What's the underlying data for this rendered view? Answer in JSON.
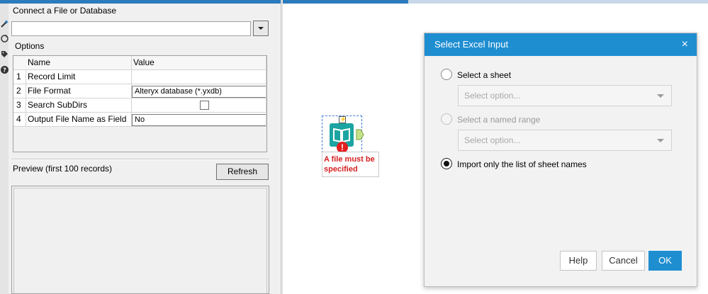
{
  "left_panel": {
    "connect_label": "Connect a File or Database",
    "connect_value": "",
    "options_label": "Options",
    "grid": {
      "headers": {
        "name": "Name",
        "value": "Value"
      },
      "rows": [
        {
          "num": "1",
          "name": "Record Limit",
          "value": ""
        },
        {
          "num": "2",
          "name": "File Format",
          "value": "Alteryx database (*.yxdb)"
        },
        {
          "num": "3",
          "name": "Search SubDirs",
          "value": ""
        },
        {
          "num": "4",
          "name": "Output File Name as Field",
          "value": "No"
        }
      ]
    },
    "preview_label": "Preview (first 100 records)",
    "refresh_label": "Refresh"
  },
  "canvas": {
    "tool_badge": "⚡",
    "error_glyph": "!",
    "error_message": "A file must be specified"
  },
  "dialog": {
    "title": "Select Excel Input",
    "close": "×",
    "options": {
      "sheet_label": "Select a sheet",
      "sheet_placeholder": "Select option...",
      "range_label": "Select a named range",
      "range_placeholder": "Select option...",
      "import_label": "Import only the list of sheet names"
    },
    "buttons": {
      "help": "Help",
      "cancel": "Cancel",
      "ok": "OK"
    }
  },
  "colors": {
    "accent": "#1f8ed1",
    "tool": "#1ba4a2",
    "error": "#e41e1e"
  },
  "icons": [
    "wand-icon",
    "refresh-circle-icon",
    "tag-icon",
    "help-icon",
    "book-icon",
    "lightning-icon"
  ]
}
